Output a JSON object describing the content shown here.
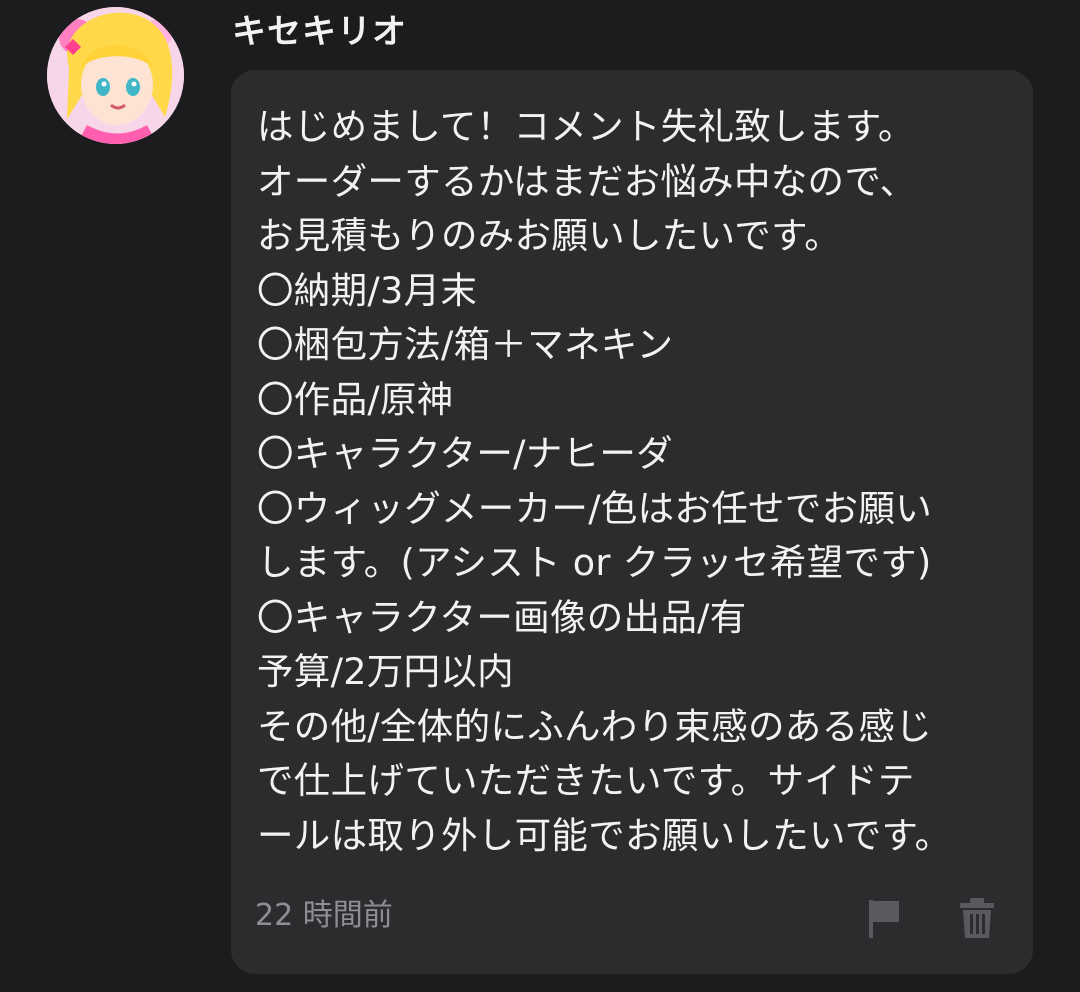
{
  "comment": {
    "username": "キセキリオ",
    "avatar_icon": "user-avatar",
    "body": "はじめまして！コメント失礼致します。\nオーダーするかはまだお悩み中なので、\nお見積もりのみお願いしたいです。\n〇納期/3月末\n〇梱包方法/箱＋マネキン\n〇作品/原神\n〇キャラクター/ナヒーダ\n〇ウィッグメーカー/色はお任せでお願い\nします。(アシスト or クラッセ希望です)\n〇キャラクター画像の出品/有\n予算/2万円以内\nその他/全体的にふんわり束感のある感じ\nで仕上げていただきたいです。サイドテ\nールは取り外し可能でお願いしたいです。",
    "timestamp": "22 時間前",
    "actions": {
      "report_icon": "flag-icon",
      "delete_icon": "trash-icon"
    }
  },
  "colors": {
    "background": "#1c1c1e",
    "bubble": "#2c2c2e",
    "text": "#f2f2f2",
    "muted": "#8e8e93",
    "icon": "#5a5a5e"
  }
}
